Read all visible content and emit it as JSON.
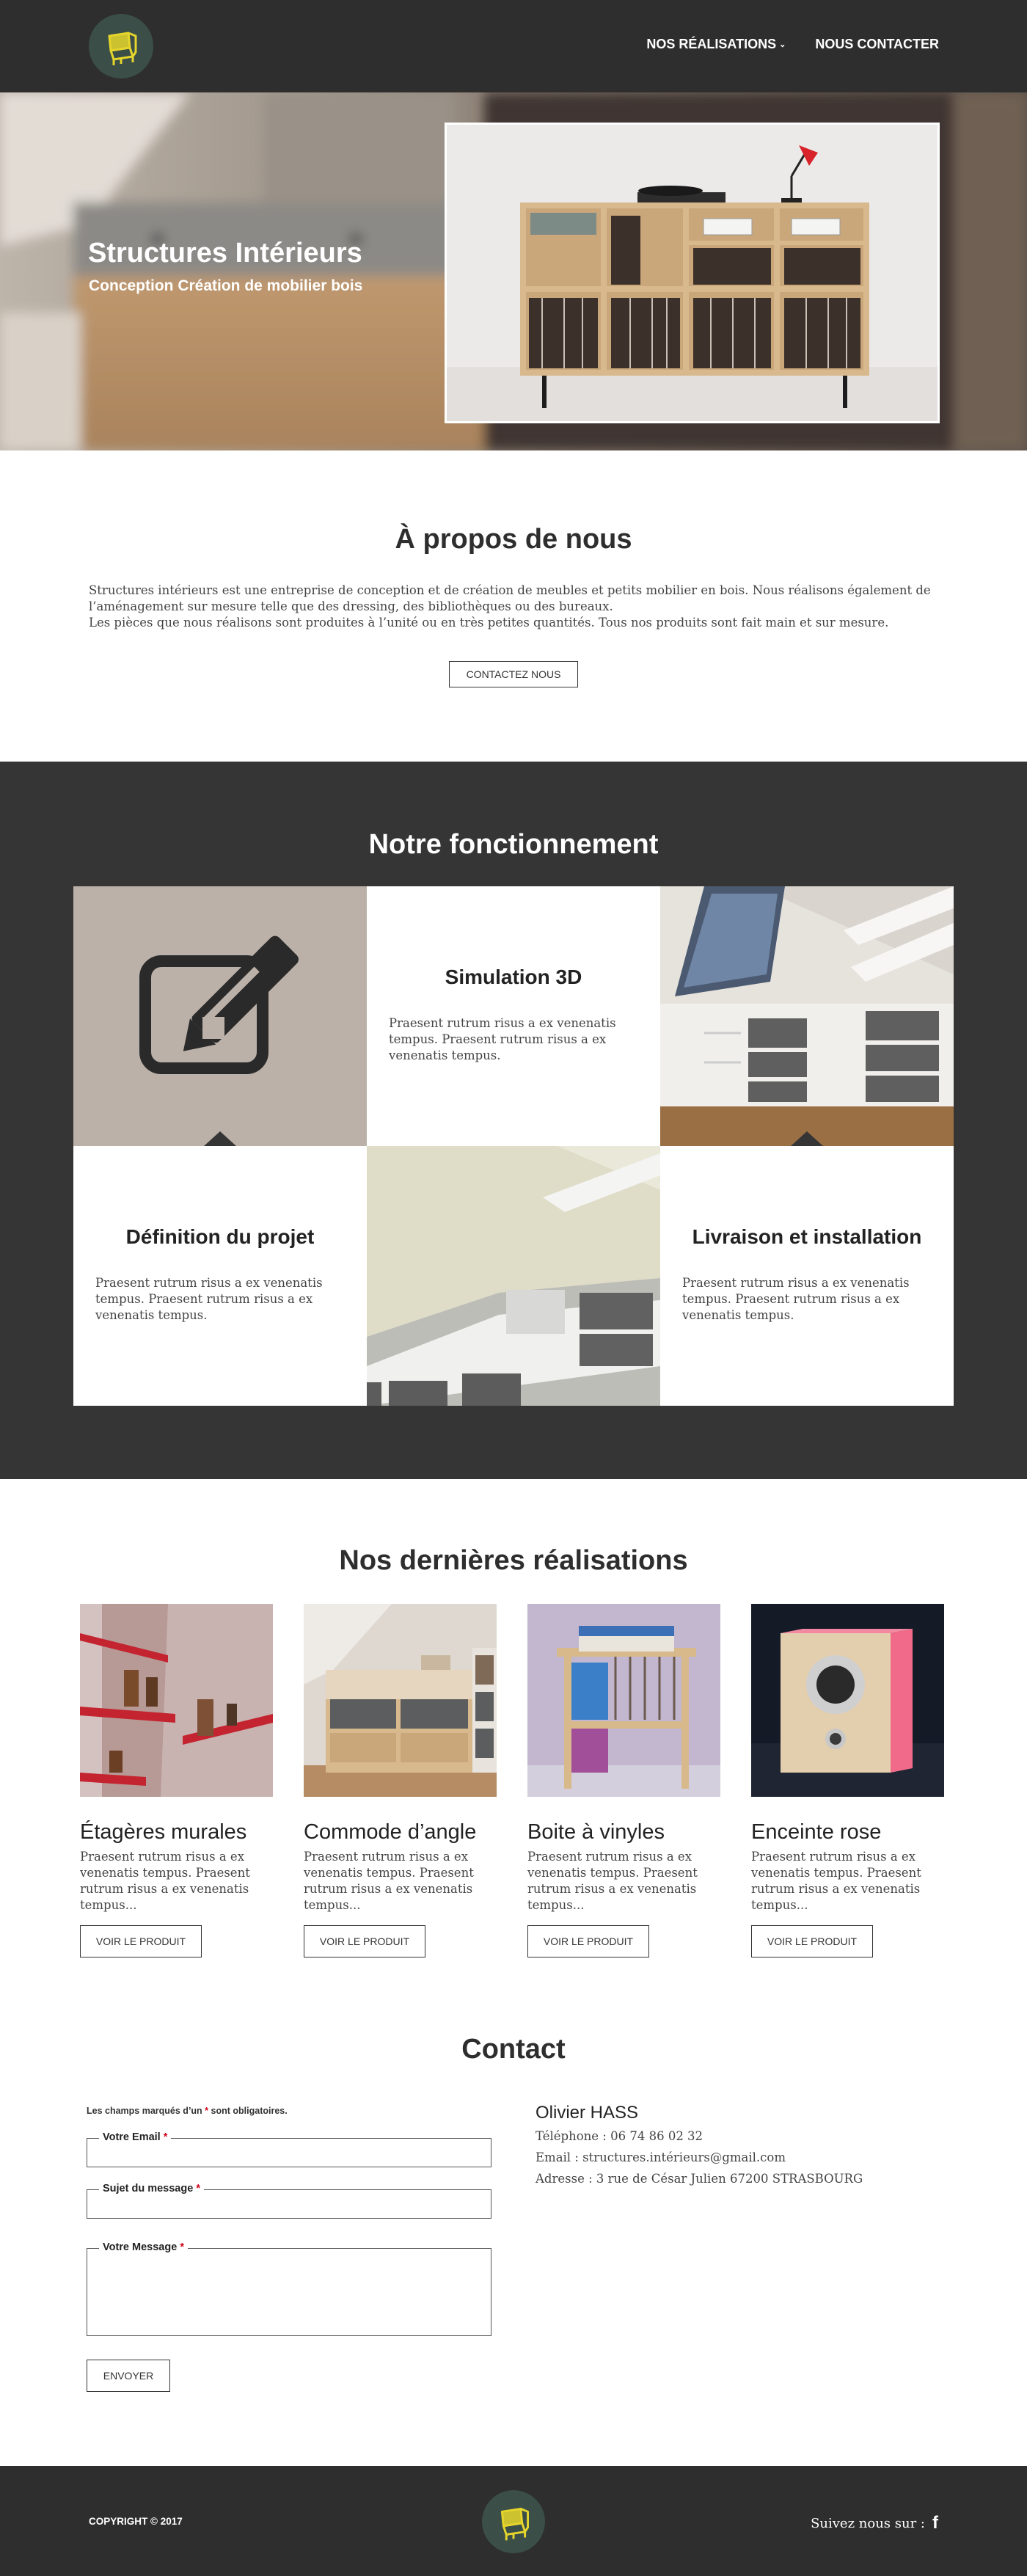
{
  "header": {
    "nav": [
      {
        "label": "NOS RÉALISATIONS"
      },
      {
        "label": "NOUS CONTACTER"
      }
    ]
  },
  "hero": {
    "title": "Structures Intérieurs",
    "subtitle": "Conception Création de mobilier bois"
  },
  "about": {
    "title": "À propos de nous",
    "paragraph_1": "Structures intérieurs est une entreprise de conception et de création de meubles et petits mobilier en bois. Nous réalisons également de l’aménagement sur mesure telle que des dressing, des bibliothèques ou des bureaux.",
    "paragraph_2": "Les pièces que nous réalisons sont produites à l’unité ou en très petites quantités. Tous nos produits sont fait main et sur mesure.",
    "button": "CONTACTEZ NOUS"
  },
  "process": {
    "title": "Notre fonctionnement",
    "steps": [
      {
        "title": "Simulation 3D",
        "text": "Praesent rutrum risus a ex venenatis tempus. Praesent rutrum risus a ex venenatis tempus."
      },
      {
        "title": "Définition du projet",
        "text": "Praesent rutrum risus a ex venenatis tempus. Praesent rutrum risus a ex venenatis tempus."
      },
      {
        "title": "Livraison et installation",
        "text": "Praesent rutrum risus a ex venenatis tempus. Praesent rutrum risus a ex venenatis tempus."
      }
    ]
  },
  "realisations": {
    "title": "Nos dernières réalisations",
    "items": [
      {
        "name": "Étagères murales",
        "desc": "Praesent rutrum risus a ex venenatis tempus. Praesent rutrum risus a ex venenatis tempus...",
        "button": "VOIR LE PRODUIT"
      },
      {
        "name": "Commode d’angle",
        "desc": "Praesent rutrum risus a ex venenatis tempus. Praesent rutrum risus a ex venenatis tempus...",
        "button": "VOIR LE PRODUIT"
      },
      {
        "name": "Boite à vinyles",
        "desc": "Praesent rutrum risus a ex venenatis tempus. Praesent rutrum risus a ex venenatis tempus...",
        "button": "VOIR LE PRODUIT"
      },
      {
        "name": "Enceinte rose",
        "desc": "Praesent rutrum risus a ex venenatis tempus. Praesent rutrum risus a ex venenatis tempus...",
        "button": "VOIR LE PRODUIT"
      }
    ]
  },
  "contact": {
    "title": "Contact",
    "required_note_before": "Les champs marqués d’un",
    "required_note_after": "sont obligatoires.",
    "required_mark": "*",
    "fields": {
      "email_label": "Votre Email",
      "subject_label": "Sujet du message",
      "message_label": "Votre Message"
    },
    "send_button": "ENVOYER",
    "info": {
      "name": "Olivier HASS",
      "phone": "Téléphone : 06 74 86 02 32",
      "email": "Email : structures.intérieurs@gmail.com",
      "address": "Adresse : 3 rue de César Julien 67200 STRASBOURG"
    }
  },
  "footer": {
    "copyright": "COPYRIGHT © 2017",
    "follow": "Suivez nous sur :",
    "facebook_icon": "f"
  },
  "colors": {
    "header_bg": "#2e2e2e",
    "section_dark": "#353535",
    "logo_bg": "#3b4e48",
    "logo_accent": "#e6d62c",
    "required": "#d0021b"
  }
}
